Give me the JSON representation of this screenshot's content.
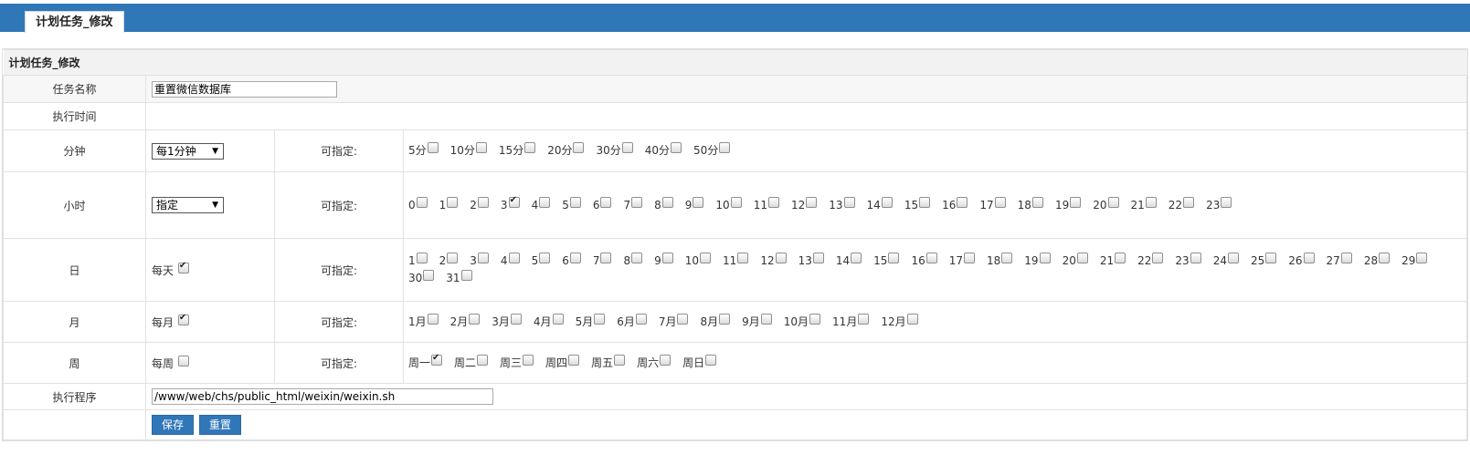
{
  "header": {
    "tab_title": "计划任务_修改"
  },
  "panel": {
    "title": "计划任务_修改"
  },
  "labels": {
    "task_name": "任务名称",
    "exec_time": "执行时间",
    "minute": "分钟",
    "hour": "小时",
    "day": "日",
    "month": "月",
    "week": "周",
    "program": "执行程序",
    "specifiable": "可指定:"
  },
  "task_name_value": "重置微信数据库",
  "minute": {
    "selected": "每1分钟",
    "options": [
      {
        "label": "5分",
        "checked": false
      },
      {
        "label": "10分",
        "checked": false
      },
      {
        "label": "15分",
        "checked": false
      },
      {
        "label": "20分",
        "checked": false
      },
      {
        "label": "30分",
        "checked": false
      },
      {
        "label": "40分",
        "checked": false
      },
      {
        "label": "50分",
        "checked": false
      }
    ]
  },
  "hour": {
    "selected": "指定",
    "options": [
      {
        "label": "0",
        "checked": false
      },
      {
        "label": "1",
        "checked": false
      },
      {
        "label": "2",
        "checked": false
      },
      {
        "label": "3",
        "checked": true
      },
      {
        "label": "4",
        "checked": false
      },
      {
        "label": "5",
        "checked": false
      },
      {
        "label": "6",
        "checked": false
      },
      {
        "label": "7",
        "checked": false
      },
      {
        "label": "8",
        "checked": false
      },
      {
        "label": "9",
        "checked": false
      },
      {
        "label": "10",
        "checked": false
      },
      {
        "label": "11",
        "checked": false
      },
      {
        "label": "12",
        "checked": false
      },
      {
        "label": "13",
        "checked": false
      },
      {
        "label": "14",
        "checked": false
      },
      {
        "label": "15",
        "checked": false
      },
      {
        "label": "16",
        "checked": false
      },
      {
        "label": "17",
        "checked": false
      },
      {
        "label": "18",
        "checked": false
      },
      {
        "label": "19",
        "checked": false
      },
      {
        "label": "20",
        "checked": false
      },
      {
        "label": "21",
        "checked": false
      },
      {
        "label": "22",
        "checked": false
      },
      {
        "label": "23",
        "checked": false
      }
    ]
  },
  "day": {
    "every_label": "每天",
    "every_checked": true,
    "options": [
      {
        "label": "1",
        "checked": false
      },
      {
        "label": "2",
        "checked": false
      },
      {
        "label": "3",
        "checked": false
      },
      {
        "label": "4",
        "checked": false
      },
      {
        "label": "5",
        "checked": false
      },
      {
        "label": "6",
        "checked": false
      },
      {
        "label": "7",
        "checked": false
      },
      {
        "label": "8",
        "checked": false
      },
      {
        "label": "9",
        "checked": false
      },
      {
        "label": "10",
        "checked": false
      },
      {
        "label": "11",
        "checked": false
      },
      {
        "label": "12",
        "checked": false
      },
      {
        "label": "13",
        "checked": false
      },
      {
        "label": "14",
        "checked": false
      },
      {
        "label": "15",
        "checked": false
      },
      {
        "label": "16",
        "checked": false
      },
      {
        "label": "17",
        "checked": false
      },
      {
        "label": "18",
        "checked": false
      },
      {
        "label": "19",
        "checked": false
      },
      {
        "label": "20",
        "checked": false
      },
      {
        "label": "21",
        "checked": false
      },
      {
        "label": "22",
        "checked": false
      },
      {
        "label": "23",
        "checked": false
      },
      {
        "label": "24",
        "checked": false
      },
      {
        "label": "25",
        "checked": false
      },
      {
        "label": "26",
        "checked": false
      },
      {
        "label": "27",
        "checked": false
      },
      {
        "label": "28",
        "checked": false
      },
      {
        "label": "29",
        "checked": false
      },
      {
        "label": "30",
        "checked": false
      },
      {
        "label": "31",
        "checked": false
      }
    ]
  },
  "month": {
    "every_label": "每月",
    "every_checked": true,
    "options": [
      {
        "label": "1月",
        "checked": false
      },
      {
        "label": "2月",
        "checked": false
      },
      {
        "label": "3月",
        "checked": false
      },
      {
        "label": "4月",
        "checked": false
      },
      {
        "label": "5月",
        "checked": false
      },
      {
        "label": "6月",
        "checked": false
      },
      {
        "label": "7月",
        "checked": false
      },
      {
        "label": "8月",
        "checked": false
      },
      {
        "label": "9月",
        "checked": false
      },
      {
        "label": "10月",
        "checked": false
      },
      {
        "label": "11月",
        "checked": false
      },
      {
        "label": "12月",
        "checked": false
      }
    ]
  },
  "week": {
    "every_label": "每周",
    "every_checked": false,
    "options": [
      {
        "label": "周一",
        "checked": true
      },
      {
        "label": "周二",
        "checked": false
      },
      {
        "label": "周三",
        "checked": false
      },
      {
        "label": "周四",
        "checked": false
      },
      {
        "label": "周五",
        "checked": false
      },
      {
        "label": "周六",
        "checked": false
      },
      {
        "label": "周日",
        "checked": false
      }
    ]
  },
  "program_value": "/www/web/chs/public_html/weixin/weixin.sh",
  "buttons": {
    "save": "保存",
    "reset": "重置"
  },
  "colors": {
    "accent": "#3077b8"
  }
}
